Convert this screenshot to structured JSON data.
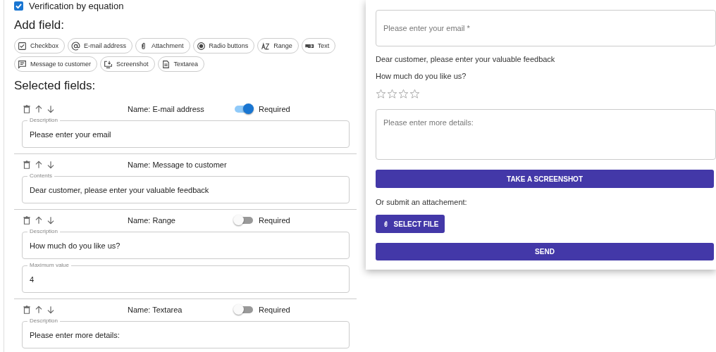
{
  "verification": {
    "label": "Verification by equation",
    "checked": true
  },
  "add_field": {
    "title": "Add field:",
    "chips": [
      {
        "label": "Checkbox",
        "kind": "checkbox"
      },
      {
        "label": "E-mail address",
        "kind": "email"
      },
      {
        "label": "Attachment",
        "kind": "attachment"
      },
      {
        "label": "Radio buttons",
        "kind": "radio"
      },
      {
        "label": "Range",
        "kind": "range"
      },
      {
        "label": "Text",
        "kind": "text"
      },
      {
        "label": "Message to customer",
        "kind": "message"
      },
      {
        "label": "Screenshot",
        "kind": "screenshot"
      },
      {
        "label": "Textarea",
        "kind": "textarea"
      }
    ]
  },
  "selected_fields": {
    "title": "Selected fields:",
    "fields": [
      {
        "name": "Name: E-mail address",
        "toggle_label": "Required",
        "required": true,
        "inputs": [
          {
            "label": "Description",
            "value": "Please enter your email"
          }
        ]
      },
      {
        "name": "Name: Message to customer",
        "inputs": [
          {
            "label": "Contents",
            "value": "Dear customer, please enter your valuable feedback"
          }
        ]
      },
      {
        "name": "Name: Range",
        "toggle_label": "Required",
        "required": false,
        "inputs": [
          {
            "label": "Description",
            "value": "How much do you like us?"
          },
          {
            "label": "Maximum value",
            "value": "4"
          }
        ]
      },
      {
        "name": "Name: Textarea",
        "toggle_label": "Required",
        "required": false,
        "inputs": [
          {
            "label": "Description",
            "value": "Please enter more details:"
          }
        ]
      }
    ]
  },
  "preview": {
    "email_placeholder": "Please enter your email *",
    "message": "Dear customer, please enter your valuable feedback",
    "rating_question": "How much do you like us?",
    "stars": 0,
    "details_placeholder": "Please enter more details:",
    "screenshot_button": "TAKE A SCREENSHOT",
    "attachment_label": "Or submit an attachement:",
    "select_file_button": "SELECT FILE",
    "send_button": "SEND"
  }
}
